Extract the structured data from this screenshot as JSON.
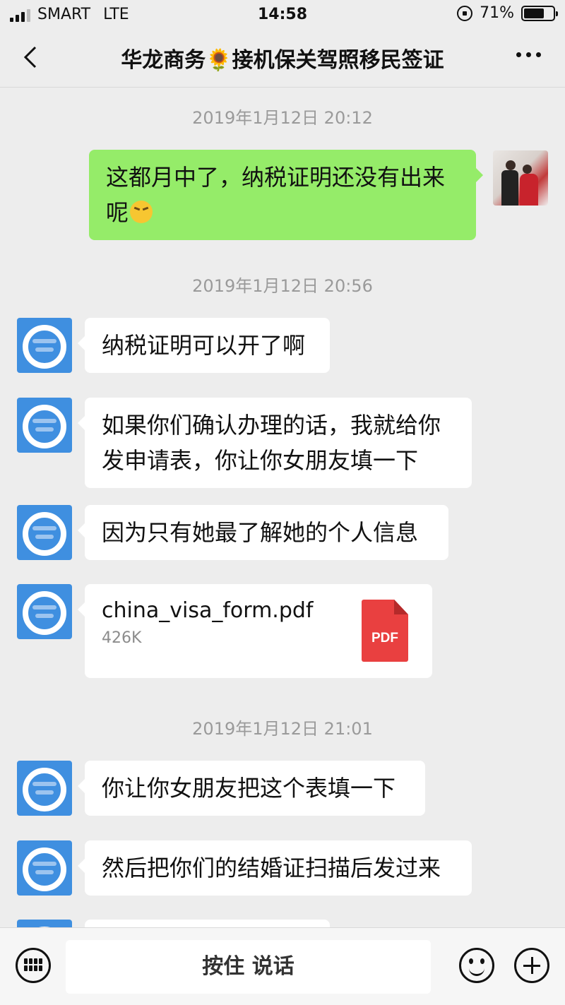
{
  "status_bar": {
    "carrier": "SMART",
    "network": "LTE",
    "time": "14:58",
    "battery": "71%",
    "battery_level": 0.71
  },
  "header": {
    "title": "华龙商务🌻接机保关驾照移民签证"
  },
  "chat": {
    "timestamps": [
      "2019年1月12日 20:12",
      "2019年1月12日 20:56",
      "2019年1月12日 21:01"
    ],
    "messages": [
      {
        "sender": "self",
        "text": "这都月中了，纳税证明还没有出来呢"
      },
      {
        "sender": "agent",
        "text": "纳税证明可以开了啊"
      },
      {
        "sender": "agent",
        "text": "如果你们确认办理的话，我就给你发申请表，你让你女朋友填一下"
      },
      {
        "sender": "agent",
        "text": "因为只有她最了解她的个人信息"
      },
      {
        "sender": "agent",
        "type": "file",
        "file_name": "china_visa_form.pdf",
        "file_size": "426K",
        "file_icon": "PDF"
      },
      {
        "sender": "agent",
        "text": "你让你女朋友把这个表填一下"
      },
      {
        "sender": "agent",
        "text": "然后把你们的结婚证扫描后发过来"
      }
    ]
  },
  "input_bar": {
    "hold_to_talk": "按住 说话"
  },
  "colors": {
    "outgoing_bubble": "#95ec69",
    "incoming_bubble": "#ffffff",
    "background": "#ededed",
    "pdf_red": "#e94040",
    "agent_avatar": "#3f8fe0"
  }
}
